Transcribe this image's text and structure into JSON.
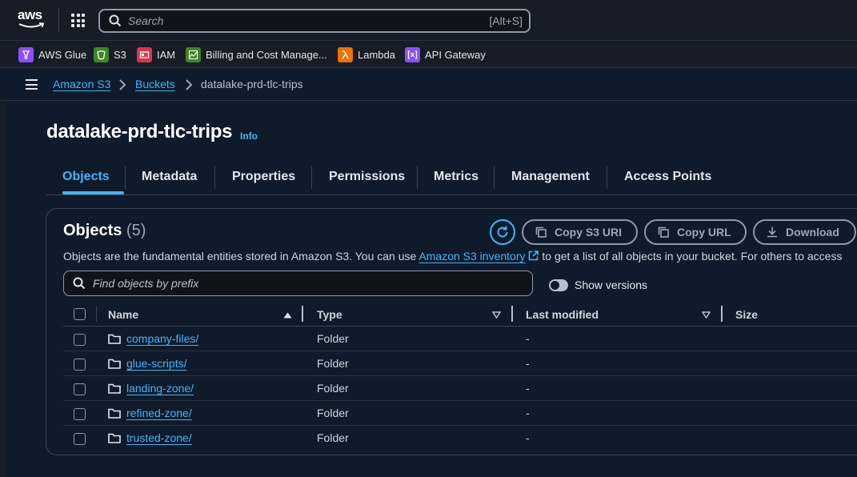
{
  "topnav": {
    "logo_text": "aws",
    "search": {
      "placeholder": "Search",
      "shortcut": "[Alt+S]"
    }
  },
  "favorites": [
    {
      "label": "AWS Glue",
      "icon": "glue-icon",
      "color": "#8c4fff"
    },
    {
      "label": "S3",
      "icon": "s3-icon",
      "color": "#3f8624"
    },
    {
      "label": "IAM",
      "icon": "iam-icon",
      "color": "#dd344c"
    },
    {
      "label": "Billing and Cost Manage...",
      "icon": "billing-icon",
      "color": "#3f8624"
    },
    {
      "label": "Lambda",
      "icon": "lambda-icon",
      "color": "#ed7100"
    },
    {
      "label": "API Gateway",
      "icon": "api-gateway-icon",
      "color": "#8c4fff"
    }
  ],
  "breadcrumb": [
    "Amazon S3",
    "Buckets",
    "datalake-prd-tlc-trips"
  ],
  "page": {
    "title": "datalake-prd-tlc-trips",
    "info": "Info"
  },
  "tabs": [
    {
      "label": "Objects",
      "active": true
    },
    {
      "label": "Metadata",
      "active": false
    },
    {
      "label": "Properties",
      "active": false
    },
    {
      "label": "Permissions",
      "active": false
    },
    {
      "label": "Metrics",
      "active": false
    },
    {
      "label": "Management",
      "active": false
    },
    {
      "label": "Access Points",
      "active": false
    }
  ],
  "objects_panel": {
    "title": "Objects",
    "count": "(5)",
    "buttons": {
      "copy_uri": "Copy S3 URI",
      "copy_url": "Copy URL",
      "download": "Download"
    },
    "description_before": "Objects are the fundamental entities stored in Amazon S3. You can use ",
    "description_link": "Amazon S3 inventory",
    "description_after": " to get a list of all objects in your bucket. For others to access",
    "filter_placeholder": "Find objects by prefix",
    "show_versions_label": "Show versions",
    "show_versions_on": false,
    "columns": {
      "name": "Name",
      "type": "Type",
      "last_modified": "Last modified",
      "size": "Size"
    },
    "rows": [
      {
        "name": "company-files/",
        "type": "Folder",
        "last_modified": "-"
      },
      {
        "name": "glue-scripts/",
        "type": "Folder",
        "last_modified": "-"
      },
      {
        "name": "landing-zone/",
        "type": "Folder",
        "last_modified": "-"
      },
      {
        "name": "refined-zone/",
        "type": "Folder",
        "last_modified": "-"
      },
      {
        "name": "trusted-zone/",
        "type": "Folder",
        "last_modified": "-"
      }
    ]
  },
  "colors": {
    "accent": "#42b4ff",
    "background": "#0f1b2a",
    "nav": "#161d26"
  }
}
